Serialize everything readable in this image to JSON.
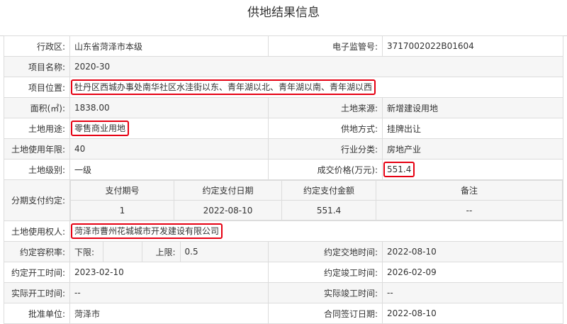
{
  "title": "供地结果信息",
  "rows": {
    "district": {
      "label": "行政区:",
      "value": "山东省菏泽市本级"
    },
    "e_supervision": {
      "label": "电子监管号:",
      "value": "3717002022B01604"
    },
    "project_name": {
      "label": "项目名称:",
      "value": "2020-30"
    },
    "project_location": {
      "label": "项目位置:",
      "value": "牡丹区西城办事处南华社区水洼街以东、青年湖以北、青年湖以南、青年湖以西"
    },
    "area": {
      "label": "面积(㎡):",
      "value": "1838.00"
    },
    "land_source": {
      "label": "土地来源:",
      "value": "新增建设用地"
    },
    "land_use": {
      "label": "土地用途:",
      "value": "零售商业用地"
    },
    "supply_method": {
      "label": "供地方式:",
      "value": "挂牌出让"
    },
    "use_years": {
      "label": "土地使用年限:",
      "value": "40"
    },
    "industry": {
      "label": "行业分类:",
      "value": "房地产业"
    },
    "land_grade": {
      "label": "土地级别:",
      "value": "一级"
    },
    "price": {
      "label": "成交价格(万元):",
      "value": "551.4"
    },
    "installments": {
      "label": "分期支付约定:",
      "headers": [
        "支付期号",
        "约定支付日期",
        "约定支付金额",
        "备注"
      ],
      "rows": [
        [
          "1",
          "2022-08-10",
          "551.4",
          "--"
        ]
      ]
    },
    "land_user": {
      "label": "土地使用权人:",
      "value": "菏泽市曹州花城城市开发建设有限公司"
    },
    "plot_ratio": {
      "label": "约定容积率:",
      "lower_label": "下限:",
      "lower_value": "",
      "upper_label": "上限:",
      "upper_value": "0.5"
    },
    "agreed_delivery": {
      "label": "约定交地时间:",
      "value": "2022-08-10"
    },
    "agreed_start": {
      "label": "约定开工时间:",
      "value": "2023-02-10"
    },
    "agreed_complete": {
      "label": "约定竣工时间:",
      "value": "2026-02-09"
    },
    "actual_start": {
      "label": "实际开工时间:",
      "value": "--"
    },
    "actual_complete": {
      "label": "实际竣工时间:",
      "value": "--"
    },
    "approval_unit": {
      "label": "批准单位:",
      "value": "菏泽市"
    },
    "contract_date": {
      "label": "合同签订日期:",
      "value": "2022-08-10"
    }
  },
  "colors": {
    "highlight_border": "#e60012",
    "border": "#dcdcdc",
    "alt_row": "#f6f6f6"
  }
}
